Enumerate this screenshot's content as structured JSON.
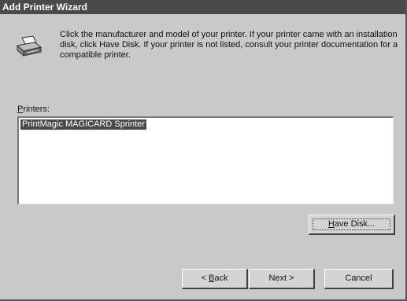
{
  "window": {
    "title": "Add Printer Wizard"
  },
  "intro": {
    "text": "Click the manufacturer and model of your printer. If your printer came with an installation disk, click Have Disk. If your printer is not listed, consult your printer documentation for a compatible printer."
  },
  "printers": {
    "label_accel": "P",
    "label_rest": "rinters:",
    "items": [
      "PrintMagic MAGICARD Sprinter"
    ],
    "selected_index": 0
  },
  "buttons": {
    "have_disk_accel": "H",
    "have_disk_rest": "ave Disk...",
    "back_prefix": "< ",
    "back_accel": "B",
    "back_rest": "ack",
    "next": "Next >",
    "cancel": "Cancel"
  },
  "icons": {
    "printer": "printer-icon"
  }
}
